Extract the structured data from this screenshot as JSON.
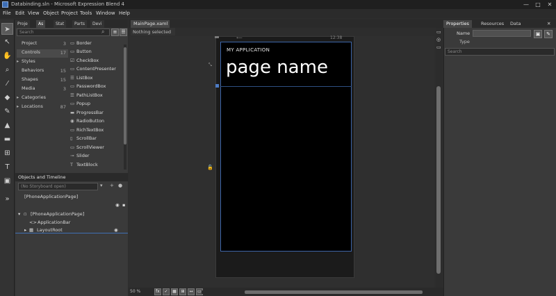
{
  "window": {
    "title": "Databinding.sln - Microsoft Expression Blend 4",
    "minimize": "—",
    "maximize": "□",
    "close": "✕"
  },
  "menu": [
    "File",
    "Edit",
    "View",
    "Object",
    "Project",
    "Tools",
    "Window",
    "Help"
  ],
  "tools": [
    "selection-arrow",
    "direct-selection",
    "pan-hand",
    "zoom",
    "eyedropper",
    "paint-bucket",
    "brush",
    "gradient",
    "rectangle",
    "grid",
    "text",
    "assets",
    "expand"
  ],
  "left_panel": {
    "tabs": [
      "Proje",
      "As",
      "Stat",
      "Parts",
      "Devi"
    ],
    "search_placeholder": "Search",
    "categories": [
      {
        "label": "Project",
        "count": "3",
        "arrow": ""
      },
      {
        "label": "Controls",
        "count": "17",
        "arrow": ""
      },
      {
        "label": "Styles",
        "count": "",
        "arrow": "▸"
      },
      {
        "label": "Behaviors",
        "count": "15",
        "arrow": ""
      },
      {
        "label": "Shapes",
        "count": "15",
        "arrow": ""
      },
      {
        "label": "Media",
        "count": "3",
        "arrow": ""
      },
      {
        "label": "Categories",
        "count": "",
        "arrow": "▸"
      },
      {
        "label": "Locations",
        "count": "87",
        "arrow": "▸"
      }
    ],
    "assets": [
      "Border",
      "Button",
      "CheckBox",
      "ContentPresenter",
      "ListBox",
      "PasswordBox",
      "PathListBox",
      "Popup",
      "ProgressBar",
      "RadioButton",
      "RichTextBox",
      "ScrollBar",
      "ScrollViewer",
      "Slider",
      "TextBlock"
    ],
    "objects_header": "Objects and Timeline",
    "objects_search": "(No Storyboard open)",
    "tree": [
      {
        "label": "[PhoneApplicationPage]"
      },
      {
        "label": "[PhoneApplicationPage]"
      },
      {
        "label": "ApplicationBar"
      },
      {
        "label": "LayoutRoot"
      }
    ]
  },
  "document": {
    "tab_label": "MainPage.xaml",
    "breadcrumb": "Nothing selected",
    "zoom": "50 %",
    "app_title": "MY APPLICATION",
    "page_title": "page name",
    "phone_status": "12:38"
  },
  "right_panel": {
    "tabs": [
      "Properties",
      "Resources",
      "Data"
    ],
    "name_label": "Name",
    "type_label": "Type",
    "search_placeholder": "Search"
  }
}
